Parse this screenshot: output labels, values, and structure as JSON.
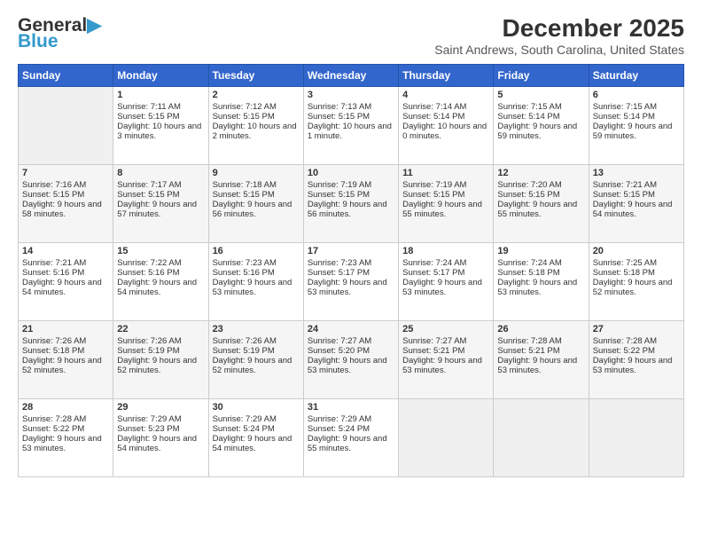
{
  "header": {
    "logo_general": "General",
    "logo_blue": "Blue",
    "month_title": "December 2025",
    "location": "Saint Andrews, South Carolina, United States"
  },
  "days_of_week": [
    "Sunday",
    "Monday",
    "Tuesday",
    "Wednesday",
    "Thursday",
    "Friday",
    "Saturday"
  ],
  "weeks": [
    [
      {
        "day": "",
        "empty": true
      },
      {
        "day": "1",
        "sunrise": "Sunrise: 7:11 AM",
        "sunset": "Sunset: 5:15 PM",
        "daylight": "Daylight: 10 hours and 3 minutes."
      },
      {
        "day": "2",
        "sunrise": "Sunrise: 7:12 AM",
        "sunset": "Sunset: 5:15 PM",
        "daylight": "Daylight: 10 hours and 2 minutes."
      },
      {
        "day": "3",
        "sunrise": "Sunrise: 7:13 AM",
        "sunset": "Sunset: 5:15 PM",
        "daylight": "Daylight: 10 hours and 1 minute."
      },
      {
        "day": "4",
        "sunrise": "Sunrise: 7:14 AM",
        "sunset": "Sunset: 5:14 PM",
        "daylight": "Daylight: 10 hours and 0 minutes."
      },
      {
        "day": "5",
        "sunrise": "Sunrise: 7:15 AM",
        "sunset": "Sunset: 5:14 PM",
        "daylight": "Daylight: 9 hours and 59 minutes."
      },
      {
        "day": "6",
        "sunrise": "Sunrise: 7:15 AM",
        "sunset": "Sunset: 5:14 PM",
        "daylight": "Daylight: 9 hours and 59 minutes."
      }
    ],
    [
      {
        "day": "7",
        "sunrise": "Sunrise: 7:16 AM",
        "sunset": "Sunset: 5:15 PM",
        "daylight": "Daylight: 9 hours and 58 minutes."
      },
      {
        "day": "8",
        "sunrise": "Sunrise: 7:17 AM",
        "sunset": "Sunset: 5:15 PM",
        "daylight": "Daylight: 9 hours and 57 minutes."
      },
      {
        "day": "9",
        "sunrise": "Sunrise: 7:18 AM",
        "sunset": "Sunset: 5:15 PM",
        "daylight": "Daylight: 9 hours and 56 minutes."
      },
      {
        "day": "10",
        "sunrise": "Sunrise: 7:19 AM",
        "sunset": "Sunset: 5:15 PM",
        "daylight": "Daylight: 9 hours and 56 minutes."
      },
      {
        "day": "11",
        "sunrise": "Sunrise: 7:19 AM",
        "sunset": "Sunset: 5:15 PM",
        "daylight": "Daylight: 9 hours and 55 minutes."
      },
      {
        "day": "12",
        "sunrise": "Sunrise: 7:20 AM",
        "sunset": "Sunset: 5:15 PM",
        "daylight": "Daylight: 9 hours and 55 minutes."
      },
      {
        "day": "13",
        "sunrise": "Sunrise: 7:21 AM",
        "sunset": "Sunset: 5:15 PM",
        "daylight": "Daylight: 9 hours and 54 minutes."
      }
    ],
    [
      {
        "day": "14",
        "sunrise": "Sunrise: 7:21 AM",
        "sunset": "Sunset: 5:16 PM",
        "daylight": "Daylight: 9 hours and 54 minutes."
      },
      {
        "day": "15",
        "sunrise": "Sunrise: 7:22 AM",
        "sunset": "Sunset: 5:16 PM",
        "daylight": "Daylight: 9 hours and 54 minutes."
      },
      {
        "day": "16",
        "sunrise": "Sunrise: 7:23 AM",
        "sunset": "Sunset: 5:16 PM",
        "daylight": "Daylight: 9 hours and 53 minutes."
      },
      {
        "day": "17",
        "sunrise": "Sunrise: 7:23 AM",
        "sunset": "Sunset: 5:17 PM",
        "daylight": "Daylight: 9 hours and 53 minutes."
      },
      {
        "day": "18",
        "sunrise": "Sunrise: 7:24 AM",
        "sunset": "Sunset: 5:17 PM",
        "daylight": "Daylight: 9 hours and 53 minutes."
      },
      {
        "day": "19",
        "sunrise": "Sunrise: 7:24 AM",
        "sunset": "Sunset: 5:18 PM",
        "daylight": "Daylight: 9 hours and 53 minutes."
      },
      {
        "day": "20",
        "sunrise": "Sunrise: 7:25 AM",
        "sunset": "Sunset: 5:18 PM",
        "daylight": "Daylight: 9 hours and 52 minutes."
      }
    ],
    [
      {
        "day": "21",
        "sunrise": "Sunrise: 7:26 AM",
        "sunset": "Sunset: 5:18 PM",
        "daylight": "Daylight: 9 hours and 52 minutes."
      },
      {
        "day": "22",
        "sunrise": "Sunrise: 7:26 AM",
        "sunset": "Sunset: 5:19 PM",
        "daylight": "Daylight: 9 hours and 52 minutes."
      },
      {
        "day": "23",
        "sunrise": "Sunrise: 7:26 AM",
        "sunset": "Sunset: 5:19 PM",
        "daylight": "Daylight: 9 hours and 52 minutes."
      },
      {
        "day": "24",
        "sunrise": "Sunrise: 7:27 AM",
        "sunset": "Sunset: 5:20 PM",
        "daylight": "Daylight: 9 hours and 53 minutes."
      },
      {
        "day": "25",
        "sunrise": "Sunrise: 7:27 AM",
        "sunset": "Sunset: 5:21 PM",
        "daylight": "Daylight: 9 hours and 53 minutes."
      },
      {
        "day": "26",
        "sunrise": "Sunrise: 7:28 AM",
        "sunset": "Sunset: 5:21 PM",
        "daylight": "Daylight: 9 hours and 53 minutes."
      },
      {
        "day": "27",
        "sunrise": "Sunrise: 7:28 AM",
        "sunset": "Sunset: 5:22 PM",
        "daylight": "Daylight: 9 hours and 53 minutes."
      }
    ],
    [
      {
        "day": "28",
        "sunrise": "Sunrise: 7:28 AM",
        "sunset": "Sunset: 5:22 PM",
        "daylight": "Daylight: 9 hours and 53 minutes."
      },
      {
        "day": "29",
        "sunrise": "Sunrise: 7:29 AM",
        "sunset": "Sunset: 5:23 PM",
        "daylight": "Daylight: 9 hours and 54 minutes."
      },
      {
        "day": "30",
        "sunrise": "Sunrise: 7:29 AM",
        "sunset": "Sunset: 5:24 PM",
        "daylight": "Daylight: 9 hours and 54 minutes."
      },
      {
        "day": "31",
        "sunrise": "Sunrise: 7:29 AM",
        "sunset": "Sunset: 5:24 PM",
        "daylight": "Daylight: 9 hours and 55 minutes."
      },
      {
        "day": "",
        "empty": true
      },
      {
        "day": "",
        "empty": true
      },
      {
        "day": "",
        "empty": true
      }
    ]
  ]
}
